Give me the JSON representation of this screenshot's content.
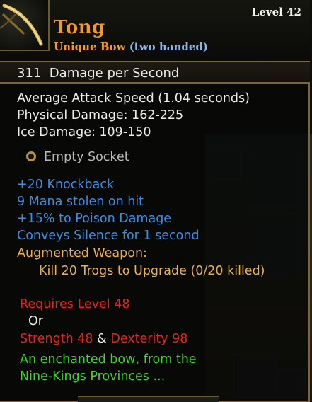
{
  "item": {
    "name": "Tong",
    "rarity": "Unique Bow",
    "handedness": "(two handed)",
    "level": "Level 42",
    "dps": "311  Damage per Second"
  },
  "stats": {
    "attack_speed": "Average Attack Speed (1.04 seconds)",
    "physical": "Physical Damage: 162-225",
    "ice": "Ice Damage: 109-150"
  },
  "socket": {
    "label": "Empty Socket"
  },
  "enchantments": [
    "+20 Knockback",
    "9 Mana stolen on hit",
    "+15% to Poison Damage",
    "Conveys Silence for 1 second"
  ],
  "augment": {
    "title": "Augmented Weapon:",
    "task": "Kill 20 Trogs to Upgrade (0/20 killed)"
  },
  "requirements": {
    "level": "Requires Level 48",
    "or": "Or",
    "strength": "Strength 48",
    "amp": "&",
    "dexterity": "Dexterity 98"
  },
  "description": {
    "line1": "An enchanted bow, from the",
    "line2": "Nine-Kings Provinces ..."
  },
  "colors": {
    "name": "#f09a28",
    "hand": "#8fb4e6",
    "enchant": "#3a8ee6",
    "augment": "#e9b048",
    "requirement": "#e5251a",
    "description": "#3fd52a",
    "border": "#7a6738"
  },
  "icons": {
    "item": "bow-icon",
    "socket": "socket-ring-icon"
  }
}
